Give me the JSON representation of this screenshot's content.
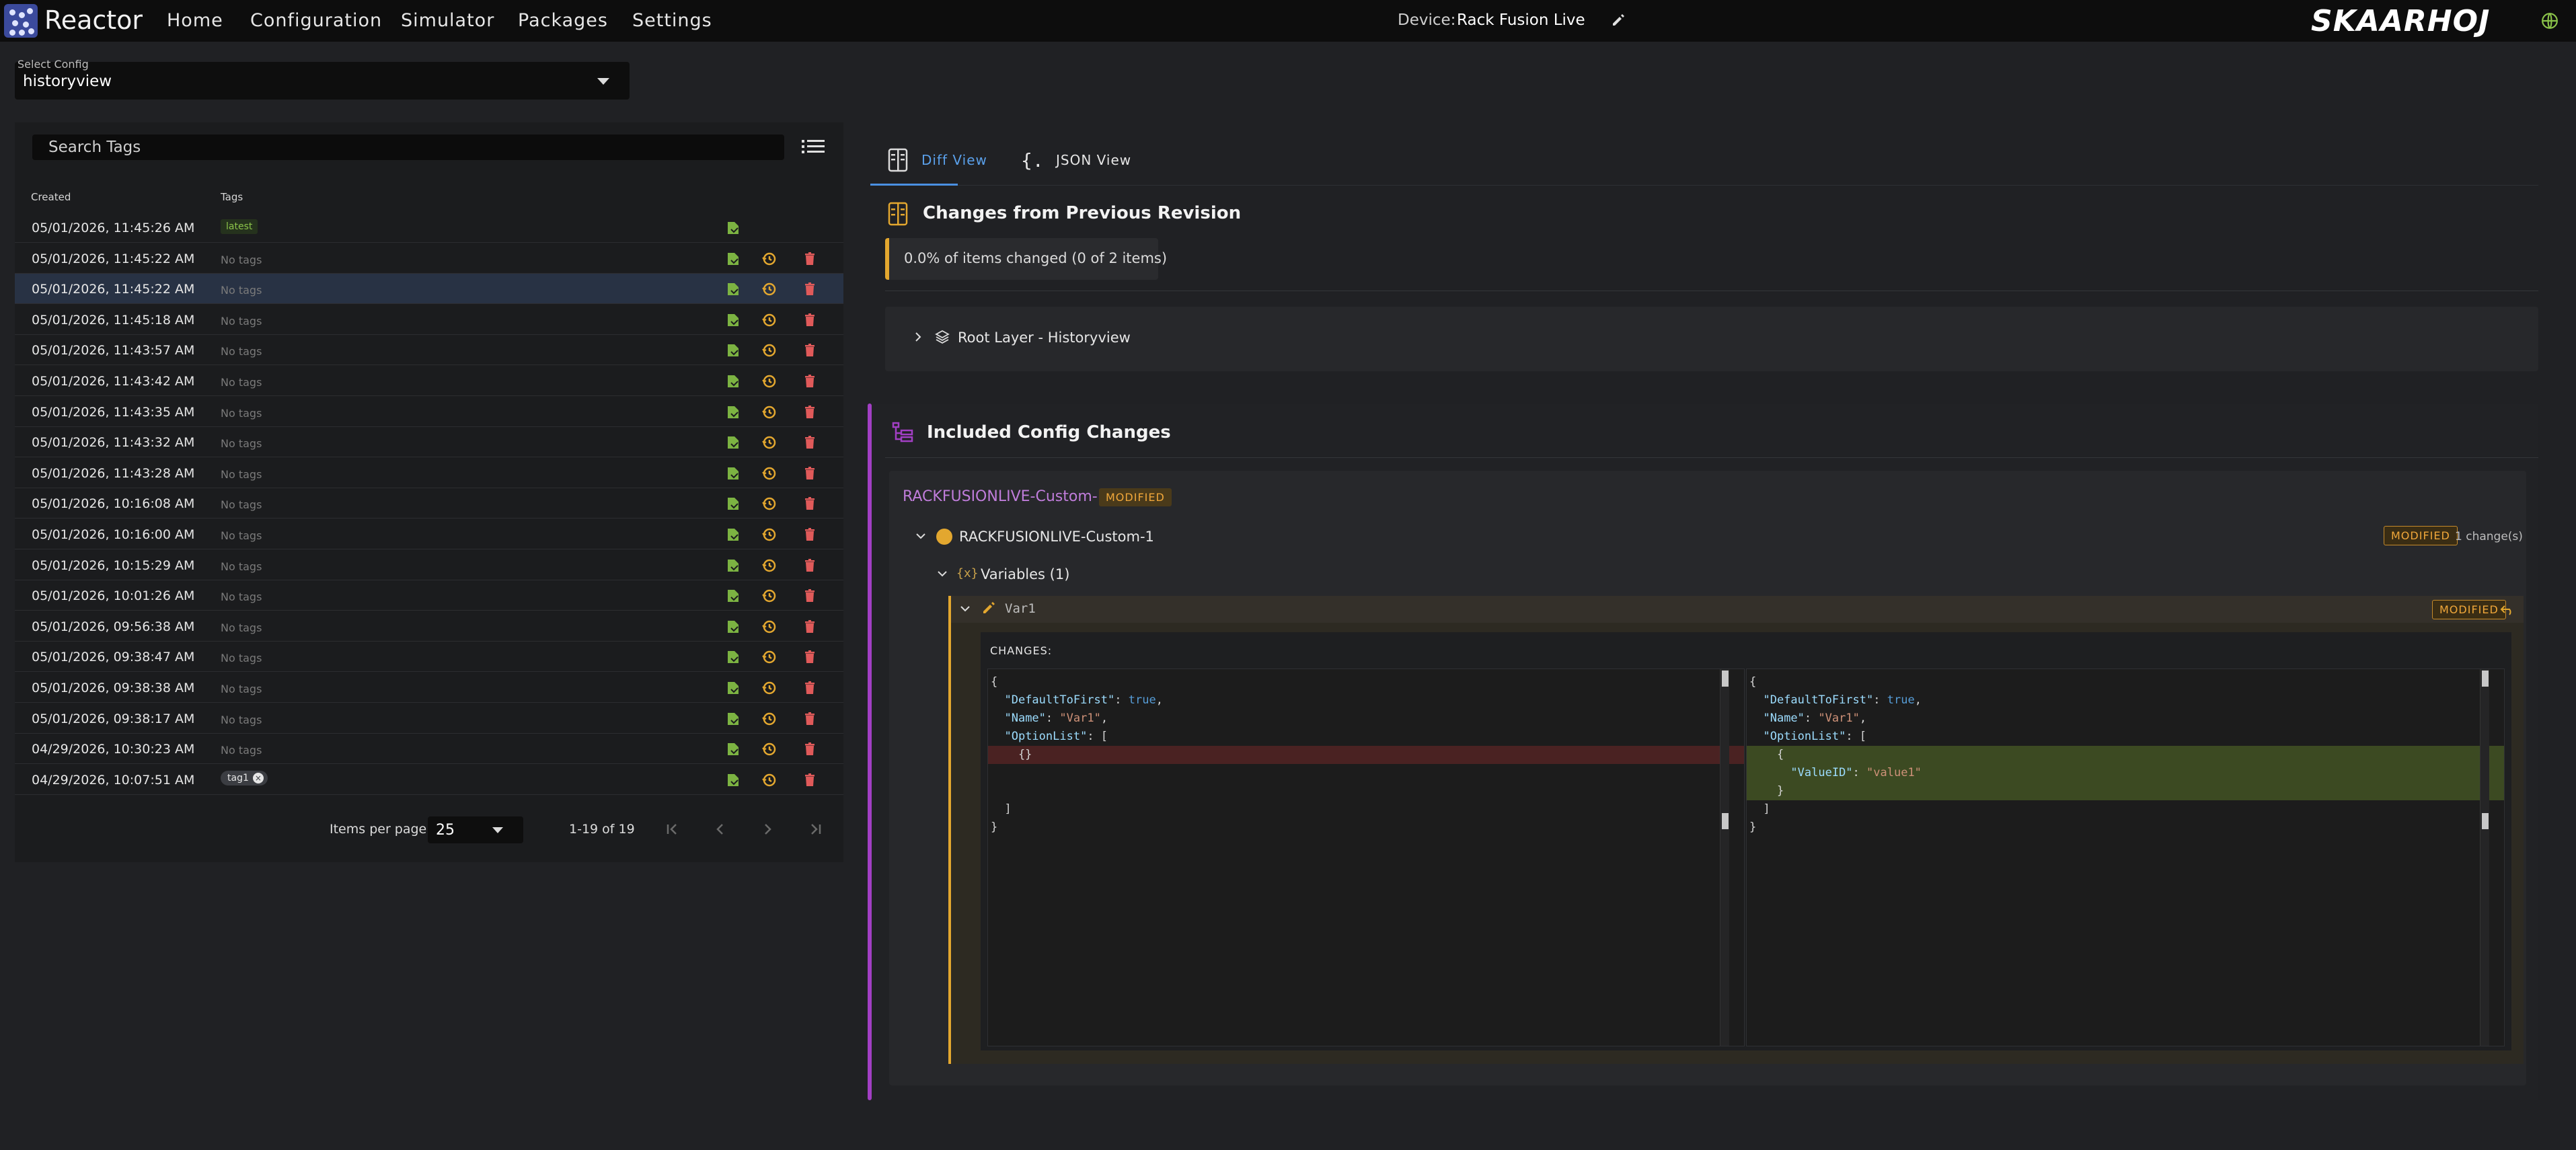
{
  "app": {
    "name": "Reactor",
    "brand": "SKAARHOJ"
  },
  "nav": [
    "Home",
    "Configuration",
    "Simulator",
    "Packages",
    "Settings"
  ],
  "device": {
    "label": "Device:",
    "name": "Rack Fusion Live"
  },
  "select_config": {
    "label": "Select Config",
    "value": "historyview"
  },
  "search": {
    "placeholder": "Search Tags"
  },
  "table": {
    "headers": {
      "created": "Created",
      "tags": "Tags"
    },
    "rows": [
      {
        "created": "05/01/2026, 11:45:26 AM",
        "tag_type": "latest",
        "tag": "latest",
        "selected": false
      },
      {
        "created": "05/01/2026, 11:45:22 AM",
        "tag_type": "none",
        "tag": "No tags",
        "selected": false
      },
      {
        "created": "05/01/2026, 11:45:22 AM",
        "tag_type": "none",
        "tag": "No tags",
        "selected": true
      },
      {
        "created": "05/01/2026, 11:45:18 AM",
        "tag_type": "none",
        "tag": "No tags",
        "selected": false
      },
      {
        "created": "05/01/2026, 11:43:57 AM",
        "tag_type": "none",
        "tag": "No tags",
        "selected": false
      },
      {
        "created": "05/01/2026, 11:43:42 AM",
        "tag_type": "none",
        "tag": "No tags",
        "selected": false
      },
      {
        "created": "05/01/2026, 11:43:35 AM",
        "tag_type": "none",
        "tag": "No tags",
        "selected": false
      },
      {
        "created": "05/01/2026, 11:43:32 AM",
        "tag_type": "none",
        "tag": "No tags",
        "selected": false
      },
      {
        "created": "05/01/2026, 11:43:28 AM",
        "tag_type": "none",
        "tag": "No tags",
        "selected": false
      },
      {
        "created": "05/01/2026, 10:16:08 AM",
        "tag_type": "none",
        "tag": "No tags",
        "selected": false
      },
      {
        "created": "05/01/2026, 10:16:00 AM",
        "tag_type": "none",
        "tag": "No tags",
        "selected": false
      },
      {
        "created": "05/01/2026, 10:15:29 AM",
        "tag_type": "none",
        "tag": "No tags",
        "selected": false
      },
      {
        "created": "05/01/2026, 10:01:26 AM",
        "tag_type": "none",
        "tag": "No tags",
        "selected": false
      },
      {
        "created": "05/01/2026, 09:56:38 AM",
        "tag_type": "none",
        "tag": "No tags",
        "selected": false
      },
      {
        "created": "05/01/2026, 09:38:47 AM",
        "tag_type": "none",
        "tag": "No tags",
        "selected": false
      },
      {
        "created": "05/01/2026, 09:38:38 AM",
        "tag_type": "none",
        "tag": "No tags",
        "selected": false
      },
      {
        "created": "05/01/2026, 09:38:17 AM",
        "tag_type": "none",
        "tag": "No tags",
        "selected": false
      },
      {
        "created": "04/29/2026, 10:30:23 AM",
        "tag_type": "none",
        "tag": "No tags",
        "selected": false
      },
      {
        "created": "04/29/2026, 10:07:51 AM",
        "tag_type": "chip",
        "tag": "tag1",
        "selected": false
      }
    ]
  },
  "pagination": {
    "label": "Items per page:",
    "per_page": "25",
    "range": "1-19 of 19"
  },
  "tabs": {
    "diff": "Diff View",
    "json": "JSON View"
  },
  "changes": {
    "title": "Changes from Previous Revision",
    "summary": "0.0% of items changed (0 of 2 items)",
    "root_layer": "Root Layer - Historyview"
  },
  "included": {
    "title": "Included Config Changes",
    "card_title": "RACKFUSIONLIVE-Custom-1",
    "badge": "MODIFIED",
    "node_label": "RACKFUSIONLIVE-Custom-1",
    "node_count": "1 change(s)",
    "vars_icon": "{x}",
    "vars_label": "Variables (1)",
    "var_name": "Var1",
    "changes_label": "CHANGES:"
  },
  "diff": {
    "left": [
      "{",
      "  \"DefaultToFirst\": true,",
      "  \"Name\": \"Var1\",",
      "  \"OptionList\": [",
      "    {}",
      "",
      "",
      "  ]",
      "}"
    ],
    "right": [
      "{",
      "  \"DefaultToFirst\": true,",
      "  \"Name\": \"Var1\",",
      "  \"OptionList\": [",
      "    {",
      "      \"ValueID\": \"value1\"",
      "    }",
      "  ]",
      "}"
    ]
  },
  "colors": {
    "accent": "#4a90e2",
    "modified": "#e3a72f",
    "included": "#a23fc4",
    "latest": "#8bc34a",
    "delete": "#e05a5a"
  }
}
